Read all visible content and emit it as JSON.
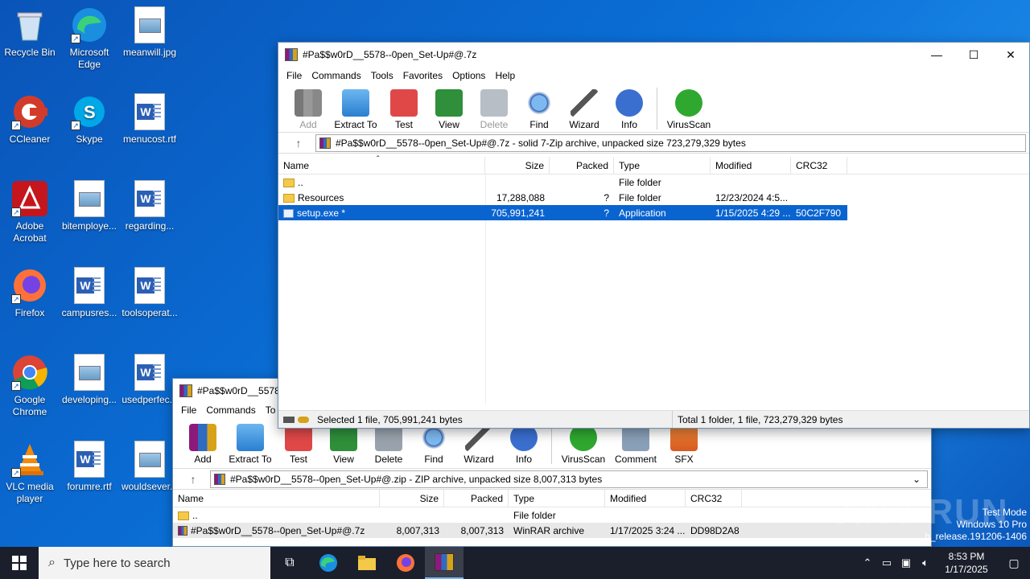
{
  "desktop": {
    "icons": [
      {
        "label": "Recycle Bin"
      },
      {
        "label": "Microsoft Edge"
      },
      {
        "label": "meanwill.jpg"
      },
      {
        "label": "CCleaner"
      },
      {
        "label": "Skype"
      },
      {
        "label": "menucost.rtf"
      },
      {
        "label": "Adobe Acrobat"
      },
      {
        "label": "bitemploye..."
      },
      {
        "label": "regarding..."
      },
      {
        "label": "Firefox"
      },
      {
        "label": "campusres..."
      },
      {
        "label": "toolsoperat..."
      },
      {
        "label": "Google Chrome"
      },
      {
        "label": "developing..."
      },
      {
        "label": "usedperfec..."
      },
      {
        "label": "VLC media player"
      },
      {
        "label": "forumre.rtf"
      },
      {
        "label": "wouldsever..."
      }
    ]
  },
  "back_window": {
    "title": "#Pa$$w0rD__5578--0pen_Set-Up#@.zip",
    "title_short": "#Pa$$w0rD__5578--",
    "menu": [
      "File",
      "Commands",
      "To"
    ],
    "toolbar": [
      "Add",
      "Extract To",
      "Test",
      "View",
      "Delete",
      "Find",
      "Wizard",
      "Info",
      "VirusScan",
      "Comment",
      "SFX"
    ],
    "path": "#Pa$$w0rD__5578--0pen_Set-Up#@.zip - ZIP archive, unpacked size 8,007,313 bytes",
    "headers": [
      "Name",
      "Size",
      "Packed",
      "Type",
      "Modified",
      "CRC32"
    ],
    "rows": [
      {
        "name": "..",
        "size": "",
        "packed": "",
        "type": "File folder",
        "modified": "",
        "crc": ""
      },
      {
        "name": "#Pa$$w0rD__5578--0pen_Set-Up#@.7z",
        "size": "8,007,313",
        "packed": "8,007,313",
        "type": "WinRAR archive",
        "modified": "1/17/2025 3:24 ...",
        "crc": "DD98D2A8"
      }
    ]
  },
  "front_window": {
    "title": "#Pa$$w0rD__5578--0pen_Set-Up#@.7z",
    "controls": {
      "minimize": "—",
      "maximize": "☐",
      "close": "✕"
    },
    "menu": [
      "File",
      "Commands",
      "Tools",
      "Favorites",
      "Options",
      "Help"
    ],
    "toolbar": [
      "Add",
      "Extract To",
      "Test",
      "View",
      "Delete",
      "Find",
      "Wizard",
      "Info",
      "VirusScan"
    ],
    "path": "#Pa$$w0rD__5578--0pen_Set-Up#@.7z - solid 7-Zip archive, unpacked size 723,279,329 bytes",
    "headers": [
      "Name",
      "Size",
      "Packed",
      "Type",
      "Modified",
      "CRC32"
    ],
    "rows": [
      {
        "name": "..",
        "size": "",
        "packed": "",
        "type": "File folder",
        "modified": "",
        "crc": ""
      },
      {
        "name": "Resources",
        "size": "17,288,088",
        "packed": "?",
        "type": "File folder",
        "modified": "12/23/2024 4:5...",
        "crc": ""
      },
      {
        "name": "setup.exe *",
        "size": "705,991,241",
        "packed": "?",
        "type": "Application",
        "modified": "1/15/2025 4:29 ...",
        "crc": "50C2F790"
      }
    ],
    "status_left": "Selected 1 file, 705,991,241 bytes",
    "status_right": "Total 1 folder, 1 file, 723,279,329 bytes"
  },
  "taskbar": {
    "search_placeholder": "Type here to search",
    "time": "8:53 PM",
    "date": "1/17/2025"
  },
  "overlay": {
    "watermark": "ANY RUN",
    "test_mode": "Test Mode",
    "os": "Windows 10 Pro",
    "build": "b_release.191206-1406"
  }
}
